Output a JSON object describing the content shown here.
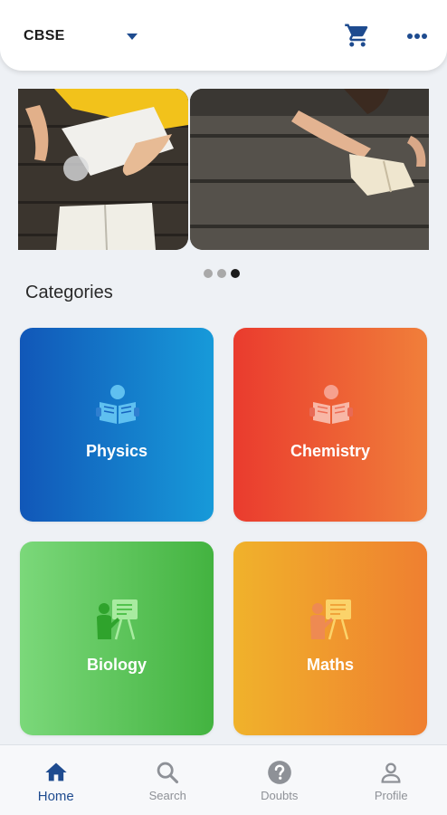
{
  "header": {
    "board": "CBSE"
  },
  "banner": {
    "slides": 3,
    "active_slide": 3
  },
  "categories_title": "Categories",
  "categories": [
    {
      "label": "Physics",
      "icon": "reading-person-icon"
    },
    {
      "label": "Chemistry",
      "icon": "reading-person-icon"
    },
    {
      "label": "Biology",
      "icon": "teacher-board-icon"
    },
    {
      "label": "Maths",
      "icon": "teacher-board-icon"
    }
  ],
  "nav": {
    "home": "Home",
    "search": "Search",
    "doubts": "Doubts",
    "profile": "Profile",
    "active": "Home"
  },
  "colors": {
    "accent": "#1e4b8f",
    "physics": [
      "#1157b8",
      "#179ad9"
    ],
    "chemistry": [
      "#ea3b2e",
      "#f07f3a"
    ],
    "biology": [
      "#7bd87a",
      "#43b340"
    ],
    "maths": [
      "#f0b22b",
      "#ef7f30"
    ]
  }
}
